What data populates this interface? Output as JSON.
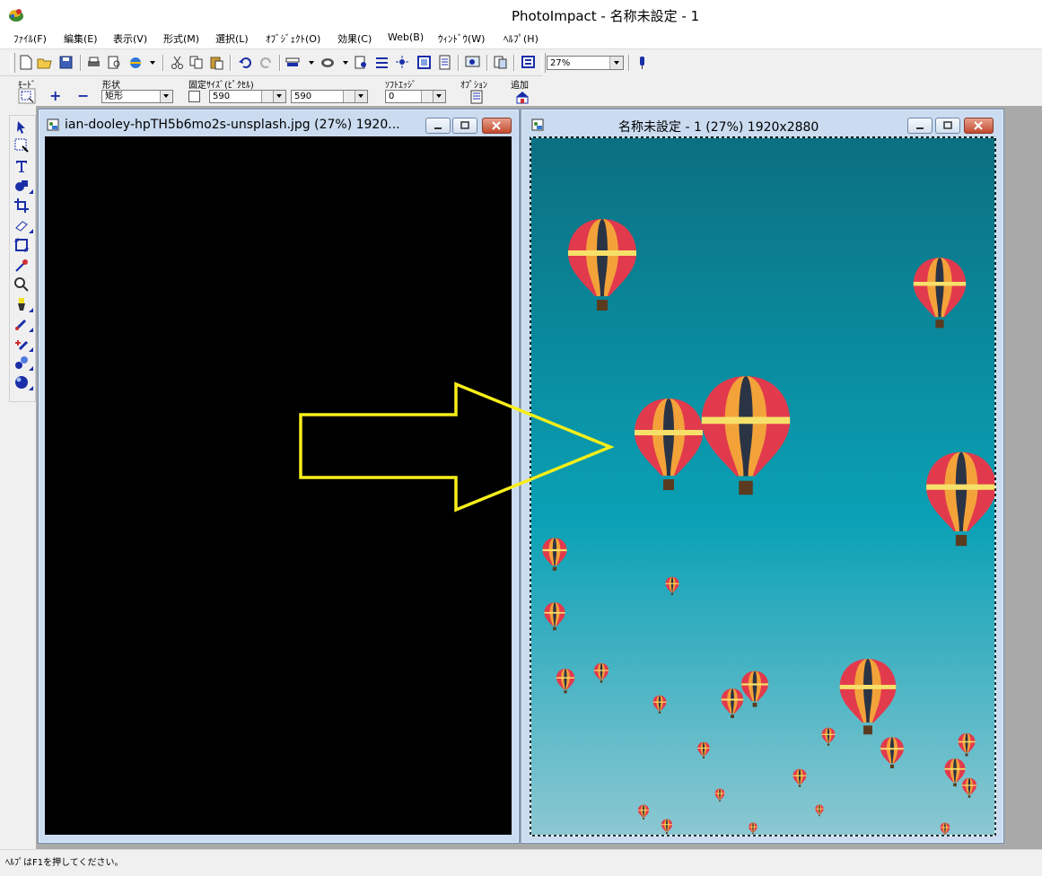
{
  "app": {
    "title": "PhotoImpact - 名称未設定 - 1"
  },
  "menu": [
    "ﾌｧｲﾙ(F)",
    "編集(E)",
    "表示(V)",
    "形式(M)",
    "選択(L)",
    "ｵﾌﾞｼﾞｪｸﾄ(O)",
    "効果(C)",
    "Web(B)",
    "ｳｨﾝﾄﾞｳ(W)",
    "ﾍﾙﾌﾟ(H)"
  ],
  "toolbar": {
    "zoom": "27%"
  },
  "attributes": {
    "mode_label": "ﾓｰﾄﾞ",
    "shape_label": "形状",
    "shape_value": "矩形",
    "fixed_size_label": "固定ｻｲｽﾞ(ﾋﾟｸｾﾙ)",
    "width_value": "590",
    "height_value": "590",
    "soft_edge_label": "ｿﾌﾄｴｯｼﾞ",
    "soft_edge_value": "0",
    "options_label": "ｵﾌﾟｼｮﾝ",
    "add_label": "追加",
    "plus_sign": "+",
    "minus_sign": "−"
  },
  "documents": {
    "left": {
      "title": "ian-dooley-hpTH5b6mo2s-unsplash.jpg (27%) 1920..."
    },
    "right": {
      "title": "名称未設定 - 1 (27%) 1920x2880"
    }
  },
  "status": {
    "text": "ﾍﾙﾌﾟはF1を押してください。"
  },
  "colors": {
    "arrow": "#f7ee1a",
    "sky_top": "#0b6f80",
    "sky_mid": "#0aa1b6",
    "sky_bottom": "#6fc0cf",
    "tool_blue": "#1a2ea8"
  }
}
